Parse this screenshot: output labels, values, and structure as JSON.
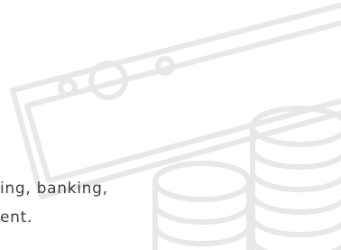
{
  "illustration": {
    "banknote_icon": "banknote-icon",
    "coins_icon": "coin-stack-icon",
    "stroke_color": "#e8e8e8"
  },
  "text": {
    "line1": "ing, banking,",
    "line2": "ent.",
    "color": "#3a3f44"
  }
}
